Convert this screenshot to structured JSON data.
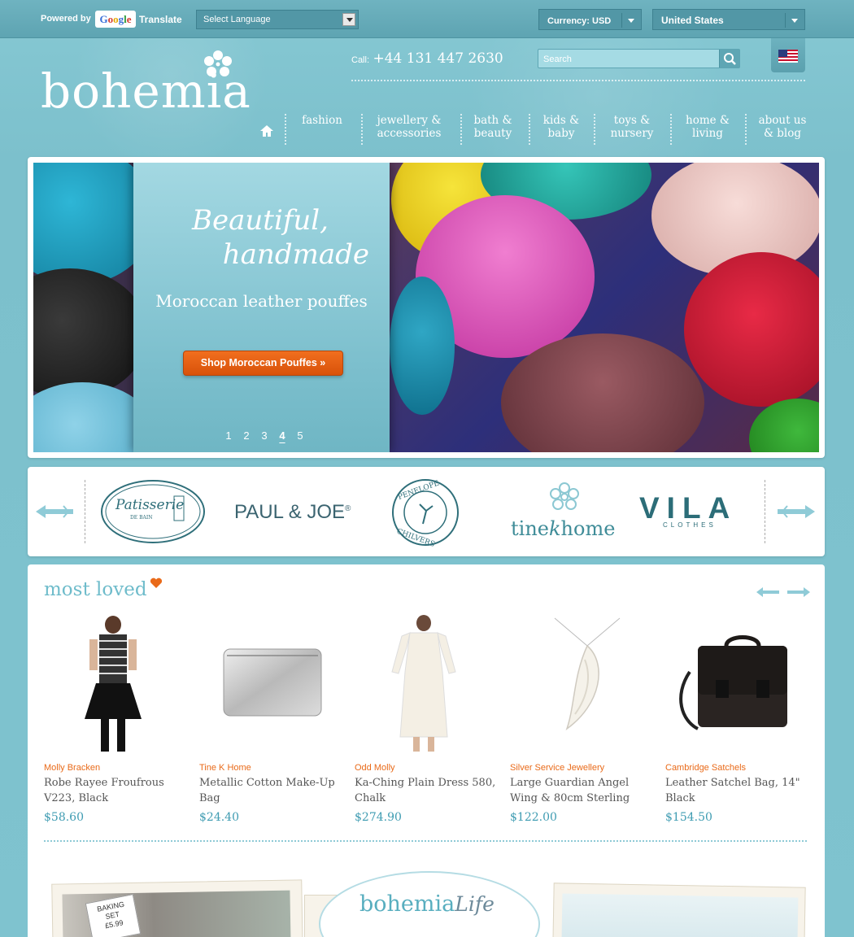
{
  "topbar": {
    "powered_by": "Powered by",
    "google": [
      "G",
      "o",
      "o",
      "g",
      "l",
      "e"
    ],
    "translate": "Translate",
    "language_select": "Select Language",
    "currency": "Currency: USD",
    "country": "United States"
  },
  "header": {
    "logo": "bohemia",
    "call_label": "Call:",
    "phone": "+44 131 447 2630",
    "search_placeholder": "Search"
  },
  "nav": {
    "items": [
      {
        "l1": "fashion",
        "l2": ""
      },
      {
        "l1": "jewellery &",
        "l2": "accessories"
      },
      {
        "l1": "bath &",
        "l2": "beauty"
      },
      {
        "l1": "kids &",
        "l2": "baby"
      },
      {
        "l1": "toys &",
        "l2": "nursery"
      },
      {
        "l1": "home &",
        "l2": "living"
      },
      {
        "l1": "about us",
        "l2": "& blog"
      }
    ]
  },
  "hero": {
    "script_line1": "Beautiful,",
    "script_line2": "handmade",
    "subtitle": "Moroccan leather pouffes",
    "cta": "Shop Moroccan Pouffes »",
    "slides": [
      "1",
      "2",
      "3",
      "4",
      "5"
    ],
    "active_slide": 4
  },
  "brands": {
    "paul": "PAUL & JOE",
    "paul_mark": "®",
    "tine": "tine",
    "tine_k": "k",
    "tine_home": "home",
    "vila": "VILA",
    "vila_sub": "CLOTHES",
    "logos": [
      "Patisserie de Bain",
      "Penelope Chilvers"
    ]
  },
  "most_loved": {
    "title": "most loved",
    "products": [
      {
        "brand": "Molly Bracken",
        "name": "Robe Rayee Froufrous V223, Black",
        "price": "$58.60"
      },
      {
        "brand": "Tine K Home",
        "name": "Metallic Cotton Make-Up Bag",
        "price": "$24.40"
      },
      {
        "brand": "Odd Molly",
        "name": "Ka-Ching Plain Dress 580, Chalk",
        "price": "$274.90"
      },
      {
        "brand": "Silver Service Jewellery",
        "name": "Large Guardian Angel Wing & 80cm Sterling",
        "price": "$122.00"
      },
      {
        "brand": "Cambridge Satchels",
        "name": "Leather Satchel Bag, 14\" Black",
        "price": "$154.50"
      }
    ]
  },
  "bohemia_life": {
    "word1": "bohemia",
    "word2": "Life",
    "polaroid_text": [
      "BAKING",
      "SET",
      "£5.99"
    ]
  },
  "colors": {
    "background": "#7fc3cf",
    "accent_orange": "#e96a19",
    "price_blue": "#3f9cb2"
  }
}
